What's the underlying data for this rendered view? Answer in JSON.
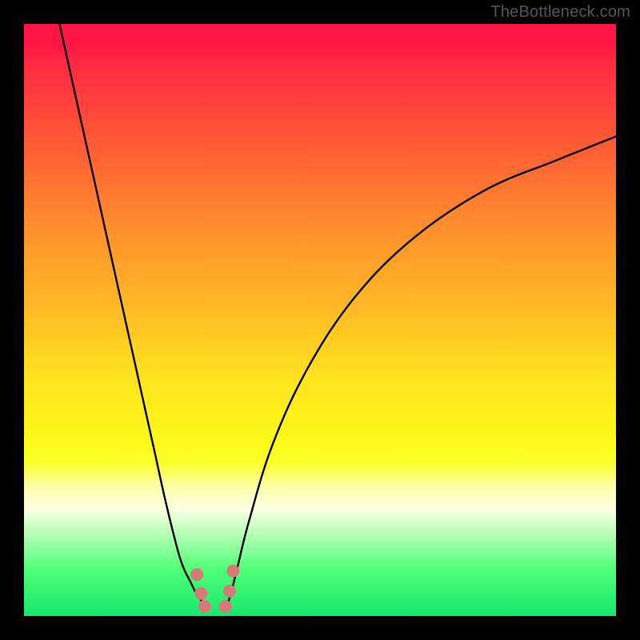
{
  "watermark": "TheBottleneck.com",
  "colors": {
    "marker": "#d77a76",
    "curve": "#000000",
    "gradient_top": "#ff1545",
    "gradient_bottom": "#17e86a"
  },
  "chart_data": {
    "type": "line",
    "title": "",
    "xlabel": "",
    "ylabel": "",
    "xlim": [
      0,
      100
    ],
    "ylim": [
      0,
      100
    ],
    "curve_left": {
      "x": [
        6,
        10,
        14,
        18,
        22,
        24,
        26,
        27,
        28,
        29,
        30,
        30.6
      ],
      "y": [
        100,
        82,
        64,
        46,
        28,
        19,
        11,
        8,
        6,
        4,
        2.5,
        1.5
      ]
    },
    "curve_right": {
      "x": [
        34.2,
        35,
        36,
        38,
        42,
        48,
        56,
        66,
        78,
        90,
        100
      ],
      "y": [
        1.5,
        4,
        8,
        16,
        29,
        42,
        54,
        64,
        72,
        77,
        81
      ]
    },
    "markers": [
      {
        "x": 29.2,
        "y": 7.0
      },
      {
        "x": 29.9,
        "y": 3.8
      },
      {
        "x": 30.5,
        "y": 1.6
      },
      {
        "x": 34.0,
        "y": 1.6
      },
      {
        "x": 34.7,
        "y": 4.2
      },
      {
        "x": 35.3,
        "y": 7.6
      }
    ],
    "marker_radius_px": 8
  }
}
